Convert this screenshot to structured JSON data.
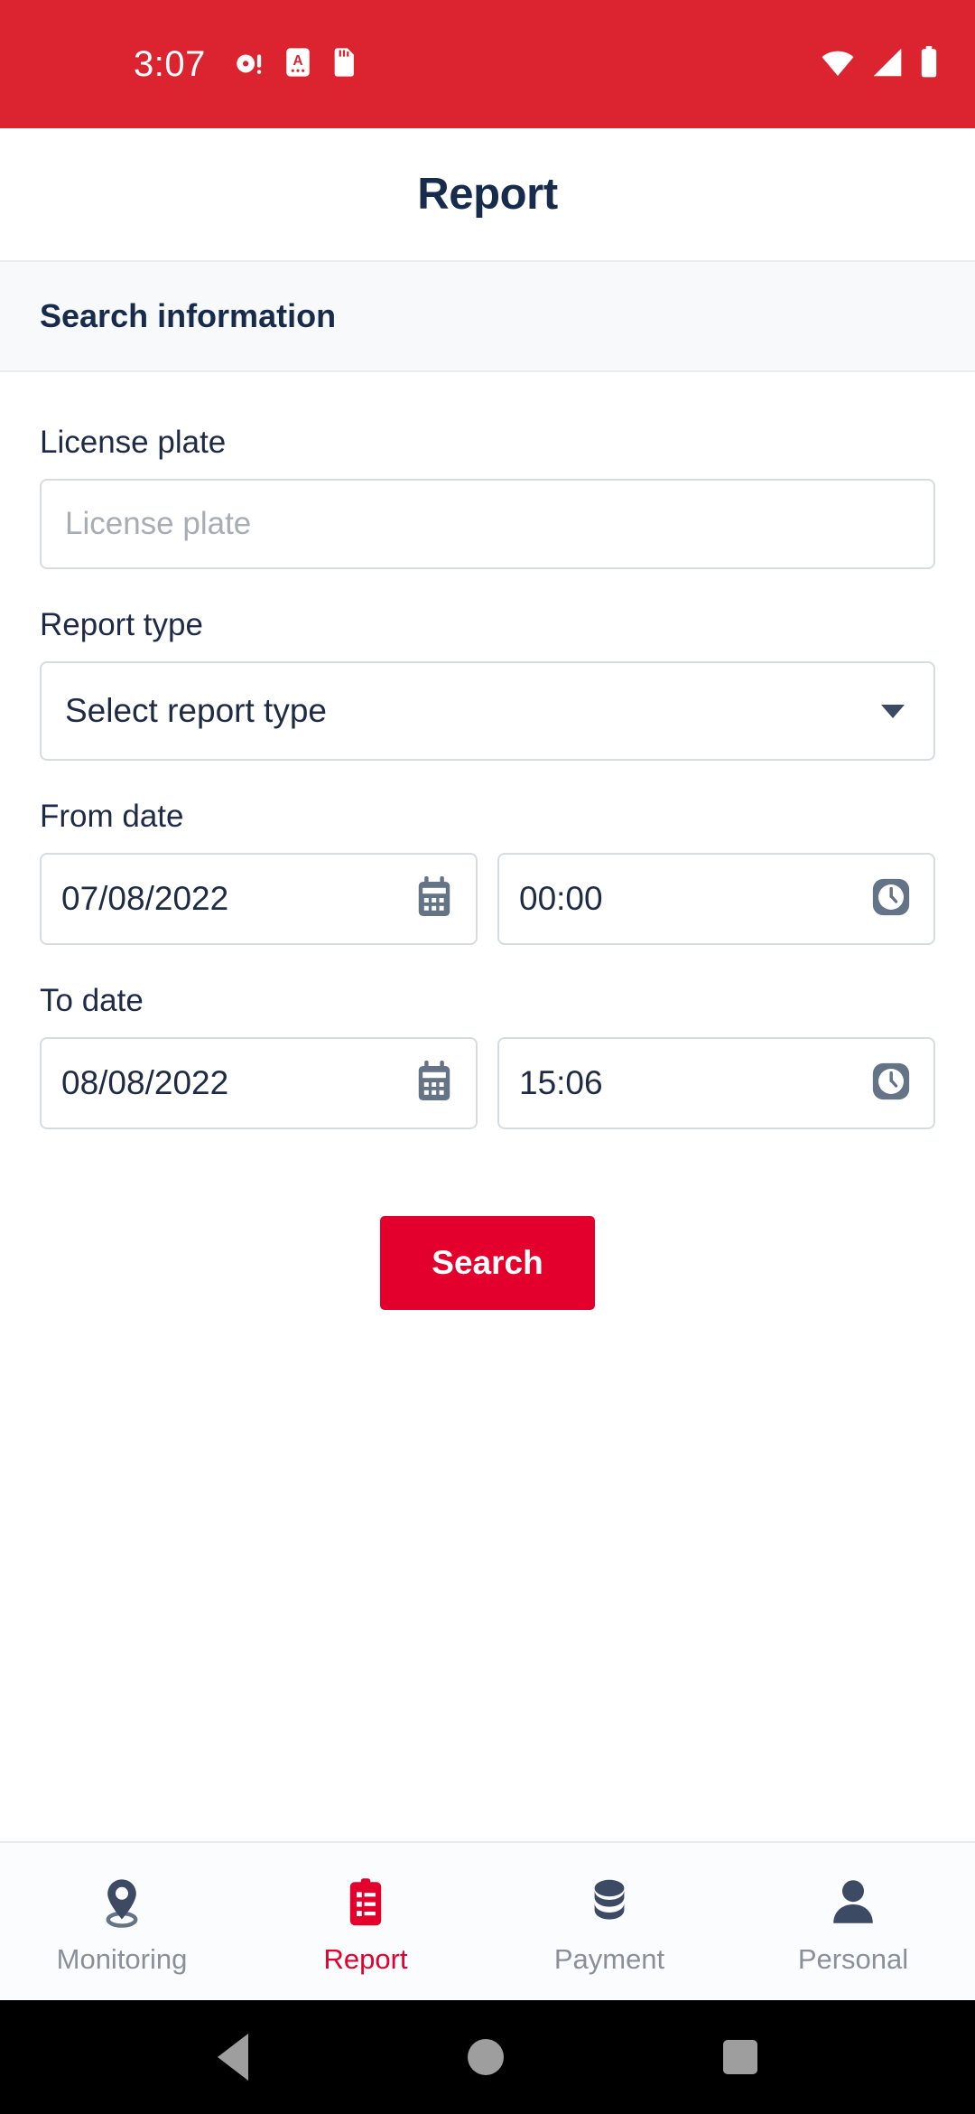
{
  "status_bar": {
    "clock": "3:07",
    "left_icons": [
      "alarm-snooze-icon",
      "auto-rotate-icon",
      "sd-card-icon"
    ],
    "right_icons": [
      "wifi-icon",
      "cellular-signal-icon",
      "battery-icon"
    ],
    "background_color": "#DC2430"
  },
  "header": {
    "title": "Report"
  },
  "section": {
    "title": "Search information"
  },
  "form": {
    "license_plate": {
      "label": "License plate",
      "placeholder": "License plate",
      "value": ""
    },
    "report_type": {
      "label": "Report type",
      "selected": "Select report type"
    },
    "from_date": {
      "label": "From date",
      "date": "07/08/2022",
      "time": "00:00"
    },
    "to_date": {
      "label": "To date",
      "date": "08/08/2022",
      "time": "15:06"
    },
    "search_button": {
      "label": "Search",
      "color": "#E3002C"
    }
  },
  "bottom_nav": {
    "active": "Report",
    "active_color": "#E3002C",
    "inactive_color": "#8a9099",
    "items": [
      {
        "label": "Monitoring",
        "icon": "map-pin-icon"
      },
      {
        "label": "Report",
        "icon": "clipboard-list-icon"
      },
      {
        "label": "Payment",
        "icon": "coins-stack-icon"
      },
      {
        "label": "Personal",
        "icon": "person-icon"
      }
    ]
  },
  "android_nav": {
    "buttons": [
      "back-button",
      "home-button",
      "recents-button"
    ]
  }
}
